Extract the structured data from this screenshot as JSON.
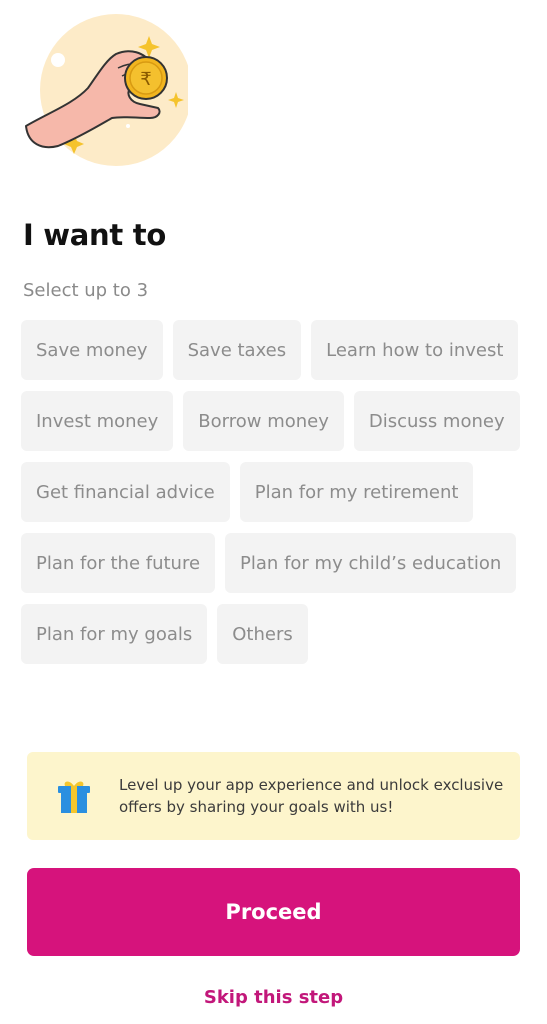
{
  "header": {
    "illustration": "hand-holding-rupee-coin-icon",
    "coin_symbol": "₹",
    "title": "I want to",
    "subtitle": "Select up to 3"
  },
  "goals": {
    "max_selectable": 3,
    "options": [
      {
        "label": "Save money",
        "selected": false
      },
      {
        "label": "Save taxes",
        "selected": false
      },
      {
        "label": "Learn how to invest",
        "selected": false
      },
      {
        "label": "Invest money",
        "selected": false
      },
      {
        "label": "Borrow money",
        "selected": false
      },
      {
        "label": "Discuss money",
        "selected": false
      },
      {
        "label": "Get financial advice",
        "selected": false
      },
      {
        "label": "Plan for my retirement",
        "selected": false
      },
      {
        "label": "Plan for the future",
        "selected": false
      },
      {
        "label": "Plan for my child’s education",
        "selected": false
      },
      {
        "label": "Plan for my goals",
        "selected": false
      },
      {
        "label": "Others",
        "selected": false
      }
    ]
  },
  "banner": {
    "icon": "gift-icon",
    "text": "Level up your app experience and unlock exclusive offers by sharing your goals with us!"
  },
  "actions": {
    "proceed_label": "Proceed",
    "skip_label": "Skip this step"
  },
  "colors": {
    "accent": "#d6137c",
    "skip_text": "#c2177a",
    "chip_bg": "#f3f3f3",
    "chip_text": "#8c8c8c",
    "banner_bg": "#fdf5cc"
  }
}
